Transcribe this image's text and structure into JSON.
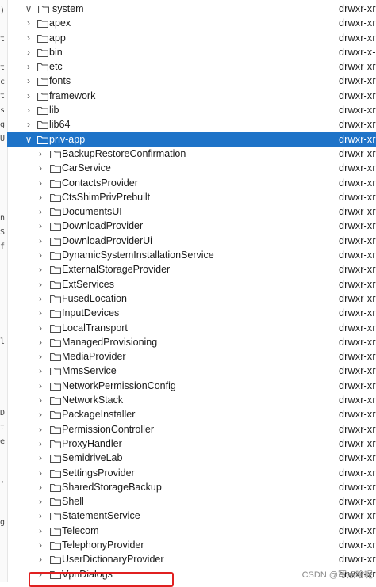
{
  "gutter_chars": [
    ")",
    "t",
    "t",
    "c",
    "t",
    "s",
    "g",
    "U",
    "n",
    "S",
    "f",
    "l",
    "D",
    "t",
    "e",
    "'",
    "g"
  ],
  "tree": {
    "root": {
      "name": "system",
      "perm": "drwxr-xr",
      "expanded": true
    },
    "children": [
      {
        "name": "apex",
        "perm": "drwxr-xr"
      },
      {
        "name": "app",
        "perm": "drwxr-xr"
      },
      {
        "name": "bin",
        "perm": "drwxr-x--"
      },
      {
        "name": "etc",
        "perm": "drwxr-xr"
      },
      {
        "name": "fonts",
        "perm": "drwxr-xr"
      },
      {
        "name": "framework",
        "perm": "drwxr-xr"
      },
      {
        "name": "lib",
        "perm": "drwxr-xr"
      },
      {
        "name": "lib64",
        "perm": "drwxr-xr"
      },
      {
        "name": "priv-app",
        "perm": "drwxr-xr",
        "expanded": true,
        "selected": true
      }
    ],
    "priv_app_children": [
      {
        "name": "BackupRestoreConfirmation",
        "perm": "drwxr-xr"
      },
      {
        "name": "CarService",
        "perm": "drwxr-xr"
      },
      {
        "name": "ContactsProvider",
        "perm": "drwxr-xr"
      },
      {
        "name": "CtsShimPrivPrebuilt",
        "perm": "drwxr-xr"
      },
      {
        "name": "DocumentsUI",
        "perm": "drwxr-xr"
      },
      {
        "name": "DownloadProvider",
        "perm": "drwxr-xr"
      },
      {
        "name": "DownloadProviderUi",
        "perm": "drwxr-xr"
      },
      {
        "name": "DynamicSystemInstallationService",
        "perm": "drwxr-xr"
      },
      {
        "name": "ExternalStorageProvider",
        "perm": "drwxr-xr"
      },
      {
        "name": "ExtServices",
        "perm": "drwxr-xr"
      },
      {
        "name": "FusedLocation",
        "perm": "drwxr-xr"
      },
      {
        "name": "InputDevices",
        "perm": "drwxr-xr"
      },
      {
        "name": "LocalTransport",
        "perm": "drwxr-xr"
      },
      {
        "name": "ManagedProvisioning",
        "perm": "drwxr-xr"
      },
      {
        "name": "MediaProvider",
        "perm": "drwxr-xr"
      },
      {
        "name": "MmsService",
        "perm": "drwxr-xr"
      },
      {
        "name": "NetworkPermissionConfig",
        "perm": "drwxr-xr"
      },
      {
        "name": "NetworkStack",
        "perm": "drwxr-xr"
      },
      {
        "name": "PackageInstaller",
        "perm": "drwxr-xr"
      },
      {
        "name": "PermissionController",
        "perm": "drwxr-xr"
      },
      {
        "name": "ProxyHandler",
        "perm": "drwxr-xr"
      },
      {
        "name": "SemidriveLab",
        "perm": "drwxr-xr"
      },
      {
        "name": "SettingsProvider",
        "perm": "drwxr-xr"
      },
      {
        "name": "SharedStorageBackup",
        "perm": "drwxr-xr"
      },
      {
        "name": "Shell",
        "perm": "drwxr-xr"
      },
      {
        "name": "StatementService",
        "perm": "drwxr-xr"
      },
      {
        "name": "Telecom",
        "perm": "drwxr-xr"
      },
      {
        "name": "TelephonyProvider",
        "perm": "drwxr-xr"
      },
      {
        "name": "UserDictionaryProvider",
        "perm": "drwxr-xr",
        "highlighted": true
      },
      {
        "name": "VpnDialogs",
        "perm": "drwxr-xr"
      }
    ]
  },
  "icons": {
    "expanded": "chevron-down-icon",
    "collapsed": "chevron-right-icon",
    "folder": "folder-icon"
  },
  "colors": {
    "selection": "#1e73c8",
    "highlight_box": "#e02020",
    "folder": "#4d4d4d"
  },
  "watermark": "CSDN @写点啥呢"
}
